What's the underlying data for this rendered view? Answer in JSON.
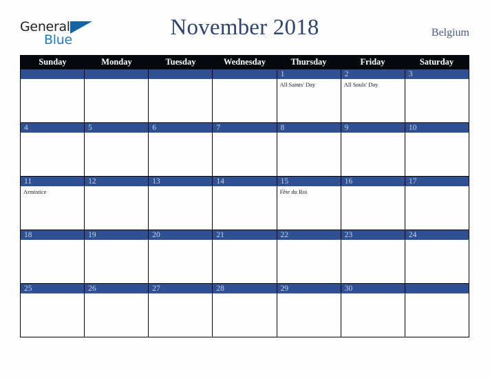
{
  "brand": {
    "line1": "General",
    "line2": "Blue",
    "triangle_color": "#1464a5",
    "line2_color": "#1a7fc1"
  },
  "header": {
    "title": "November 2018",
    "country": "Belgium",
    "title_color": "#2e4470"
  },
  "calendar": {
    "weekday_headers": [
      "Sunday",
      "Monday",
      "Tuesday",
      "Wednesday",
      "Thursday",
      "Friday",
      "Saturday"
    ],
    "header_bg": "#05080d",
    "daybar_bg": "#2f5092",
    "daynum_color": "#c9d3e6",
    "weeks": [
      [
        {
          "day": "",
          "events": []
        },
        {
          "day": "",
          "events": []
        },
        {
          "day": "",
          "events": []
        },
        {
          "day": "",
          "events": []
        },
        {
          "day": "1",
          "events": [
            "All Saints' Day"
          ]
        },
        {
          "day": "2",
          "events": [
            "All Souls' Day"
          ]
        },
        {
          "day": "3",
          "events": []
        }
      ],
      [
        {
          "day": "4",
          "events": []
        },
        {
          "day": "5",
          "events": []
        },
        {
          "day": "6",
          "events": []
        },
        {
          "day": "7",
          "events": []
        },
        {
          "day": "8",
          "events": []
        },
        {
          "day": "9",
          "events": []
        },
        {
          "day": "10",
          "events": []
        }
      ],
      [
        {
          "day": "11",
          "events": [
            "Armistice"
          ]
        },
        {
          "day": "12",
          "events": []
        },
        {
          "day": "13",
          "events": []
        },
        {
          "day": "14",
          "events": []
        },
        {
          "day": "15",
          "events": [
            "Fête du Roi"
          ]
        },
        {
          "day": "16",
          "events": []
        },
        {
          "day": "17",
          "events": []
        }
      ],
      [
        {
          "day": "18",
          "events": []
        },
        {
          "day": "19",
          "events": []
        },
        {
          "day": "20",
          "events": []
        },
        {
          "day": "21",
          "events": []
        },
        {
          "day": "22",
          "events": []
        },
        {
          "day": "23",
          "events": []
        },
        {
          "day": "24",
          "events": []
        }
      ],
      [
        {
          "day": "25",
          "events": []
        },
        {
          "day": "26",
          "events": []
        },
        {
          "day": "27",
          "events": []
        },
        {
          "day": "28",
          "events": []
        },
        {
          "day": "29",
          "events": []
        },
        {
          "day": "30",
          "events": []
        },
        {
          "day": "",
          "events": []
        }
      ]
    ]
  }
}
